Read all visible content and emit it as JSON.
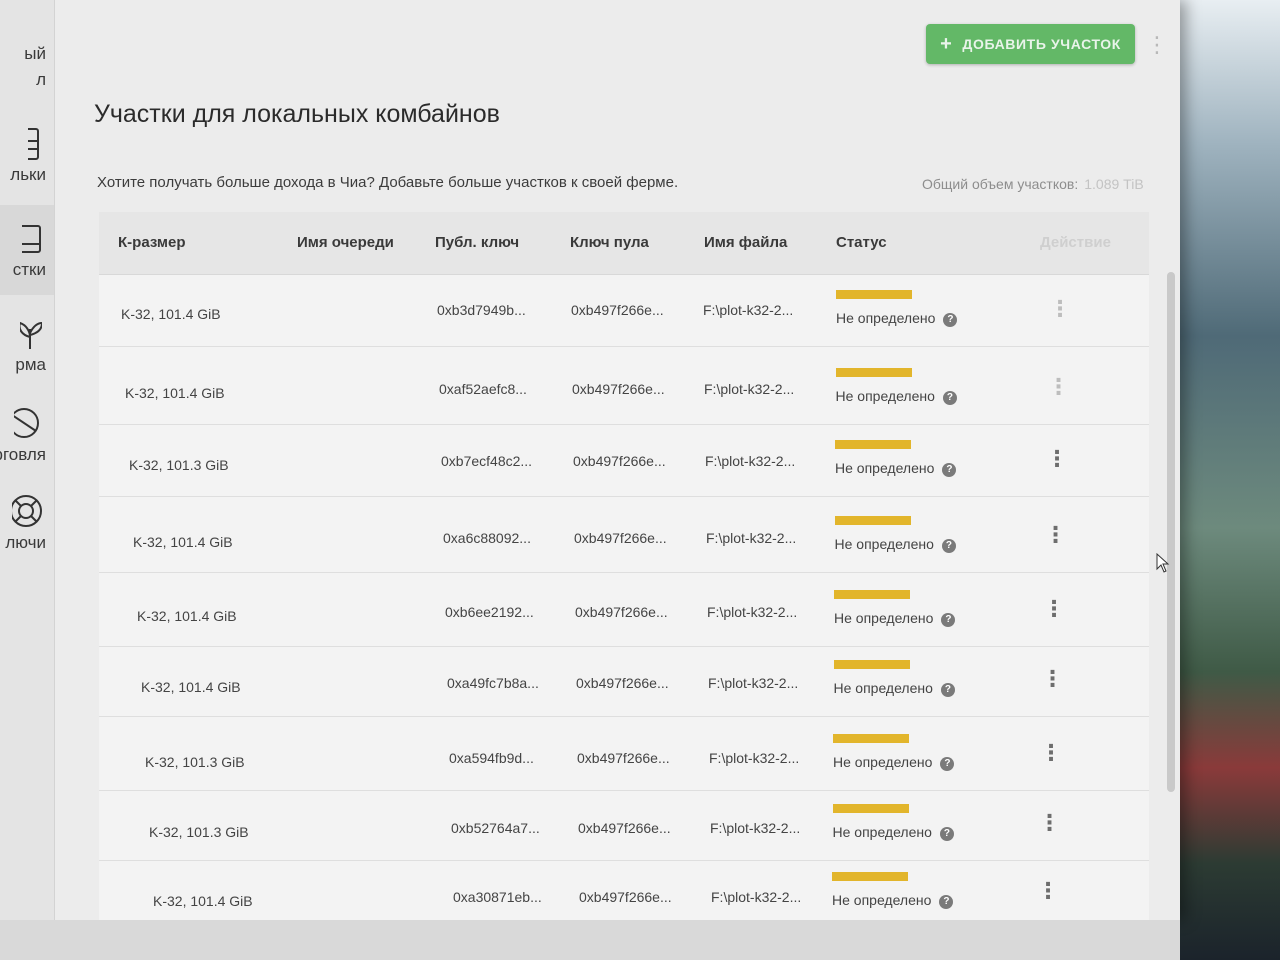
{
  "sidebar": {
    "items": [
      {
        "label": "ый\nл",
        "icon": "wallet-icon"
      },
      {
        "label": "льки",
        "icon": "wallet-icon"
      },
      {
        "label": "стки",
        "icon": "hard-drive-icon"
      },
      {
        "label": "рма",
        "icon": "sprout-icon"
      },
      {
        "label": "рговля",
        "icon": "trade-icon"
      },
      {
        "label": "лючи",
        "icon": "lifebuoy-icon"
      }
    ]
  },
  "header": {
    "add_button_label": "ДОБАВИТЬ УЧАСТОК",
    "add_button_icon": "+"
  },
  "main": {
    "title": "Участки для локальных комбайнов",
    "subtitle": "Хотите получать больше дохода в Чиа? Добавьте больше участков к своей ферме.",
    "total_label": "Общий объем участков:",
    "total_value": "1.089 TiB"
  },
  "table": {
    "columns": [
      "К-размер",
      "Имя очереди",
      "Публ. ключ",
      "Ключ пула",
      "Имя файла",
      "Статус",
      "Действие"
    ],
    "rows": [
      {
        "size": "K-32, 101.4 GiB",
        "queue": "",
        "pubkey": "0xb3d7949b...",
        "poolkey": "0xb497f266e...",
        "file": "F:\\plot-k32-2...",
        "status": "Не определено"
      },
      {
        "size": "K-32, 101.4 GiB",
        "queue": "",
        "pubkey": "0xaf52aefc8...",
        "poolkey": "0xb497f266e...",
        "file": "F:\\plot-k32-2...",
        "status": "Не определено"
      },
      {
        "size": "K-32, 101.3 GiB",
        "queue": "",
        "pubkey": "0xb7ecf48c2...",
        "poolkey": "0xb497f266e...",
        "file": "F:\\plot-k32-2...",
        "status": "Не определено"
      },
      {
        "size": "K-32, 101.4 GiB",
        "queue": "",
        "pubkey": "0xa6c88092...",
        "poolkey": "0xb497f266e...",
        "file": "F:\\plot-k32-2...",
        "status": "Не определено"
      },
      {
        "size": "K-32, 101.4 GiB",
        "queue": "",
        "pubkey": "0xb6ee2192...",
        "poolkey": "0xb497f266e...",
        "file": "F:\\plot-k32-2...",
        "status": "Не определено"
      },
      {
        "size": "K-32, 101.4 GiB",
        "queue": "",
        "pubkey": "0xa49fc7b8a...",
        "poolkey": "0xb497f266e...",
        "file": "F:\\plot-k32-2...",
        "status": "Не определено"
      },
      {
        "size": "K-32, 101.3 GiB",
        "queue": "",
        "pubkey": "0xa594fb9d...",
        "poolkey": "0xb497f266e...",
        "file": "F:\\plot-k32-2...",
        "status": "Не определено"
      },
      {
        "size": "K-32, 101.3 GiB",
        "queue": "",
        "pubkey": "0xb52764a7...",
        "poolkey": "0xb497f266e...",
        "file": "F:\\plot-k32-2...",
        "status": "Не определено"
      },
      {
        "size": "K-32, 101.4 GiB",
        "queue": "",
        "pubkey": "0xa30871eb...",
        "poolkey": "0xb497f266e...",
        "file": "F:\\plot-k32-2...",
        "status": "Не определено"
      }
    ]
  },
  "colors": {
    "accent": "#4caf50",
    "status_bar": "#e2b52b"
  }
}
